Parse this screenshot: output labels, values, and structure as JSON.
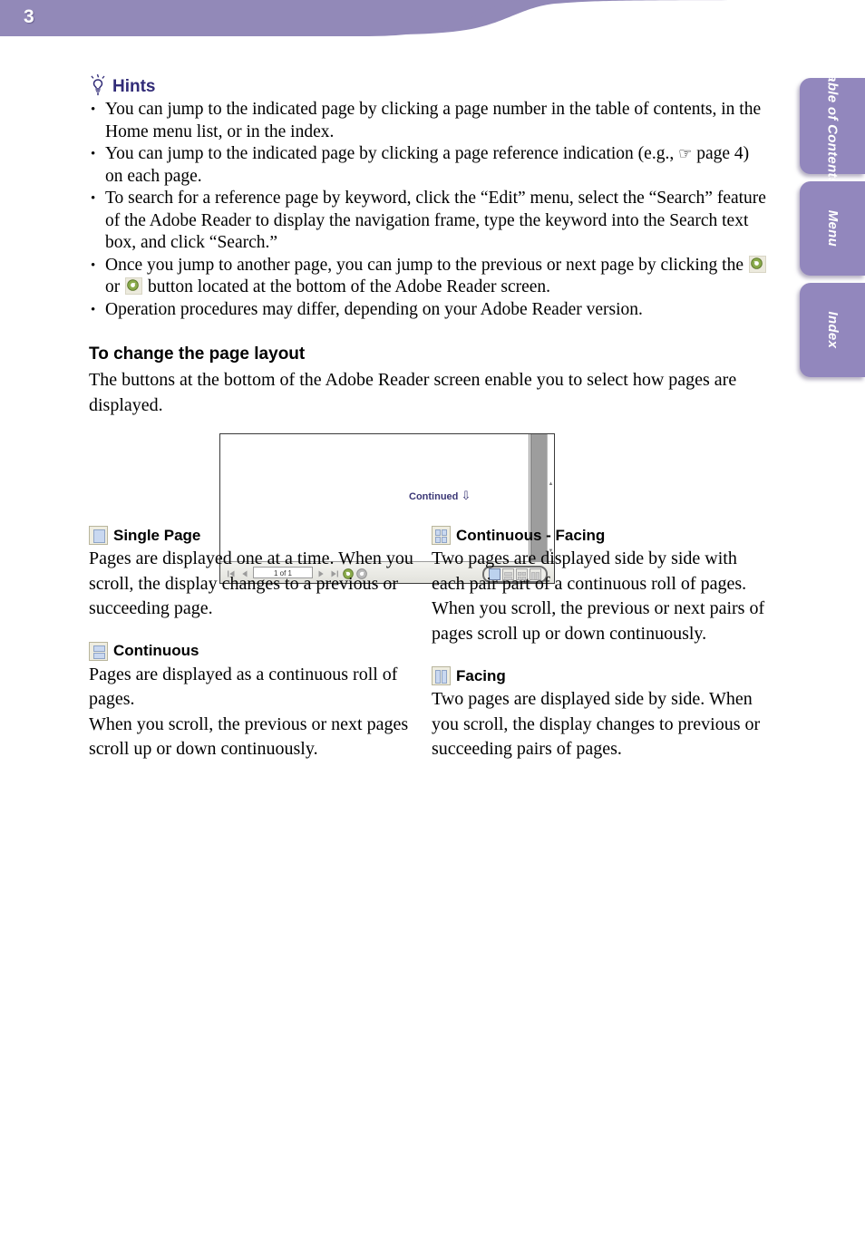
{
  "header": {
    "page_number": "3",
    "band_color": "#9289b8"
  },
  "side_tabs": [
    {
      "label": "Table of Contents",
      "name": "table-of-contents"
    },
    {
      "label": "Menu",
      "name": "menu"
    },
    {
      "label": "Index",
      "name": "index"
    }
  ],
  "hints": {
    "title": "Hints",
    "title_color": "#312b77",
    "items": [
      {
        "text_before": "You can jump to the indicated page by clicking a page number in the table of contents, in the Home menu list, or in the index.",
        "text_after": ""
      },
      {
        "text_before": "You can jump to the indicated page by clicking a page reference indication (e.g., ",
        "glyph": "☞",
        "text_after": " page 4) on each page."
      },
      {
        "text_before": "To search for a reference page by keyword, click the “Edit” menu, select the “Search” feature of the Adobe Reader to display the navigation frame, type the keyword into the Search text box, and click “Search.”",
        "text_after": ""
      },
      {
        "text_before": "Once you jump to another page, you can jump to the previous or next page by clicking the ",
        "text_middle": " or ",
        "text_after": " button located at the bottom of the Adobe Reader screen."
      },
      {
        "text_before": "Operation procedures may differ, depending on your Adobe Reader version.",
        "text_after": ""
      }
    ]
  },
  "layout_section": {
    "heading": "To change the page layout",
    "intro": "The buttons at the bottom of the Adobe Reader screen enable you to select how pages are displayed."
  },
  "reader_figure": {
    "continued_label": "Continued",
    "continued_arrow": "⇩",
    "page_indicator": "1 of 1",
    "scroll_up_arrow": "▲",
    "scroll_down_arrow": "▼"
  },
  "modes": {
    "single_page": {
      "title": "Single Page",
      "body": "Pages are displayed one at a time. When you scroll, the display changes to a previous or succeeding page."
    },
    "continuous": {
      "title": "Continuous",
      "body_line1": "Pages are displayed as a continuous roll of pages.",
      "body_line2": "When you scroll, the previous or next pages scroll up or down continuously."
    },
    "continuous_facing": {
      "title": "Continuous - Facing",
      "body": "Two pages are displayed side by side with each pair part of a continuous roll of pages. When you scroll, the previous or next pairs of pages scroll up or down continuously."
    },
    "facing": {
      "title": "Facing",
      "body": "Two pages are displayed side by side. When you scroll, the display changes to previous or succeeding pairs of pages."
    }
  },
  "colors": {
    "accent_purple": "#9289b8",
    "tab_purple": "#9287bd",
    "heading_navy": "#312b77",
    "icon_green": "#7a9a3c"
  }
}
